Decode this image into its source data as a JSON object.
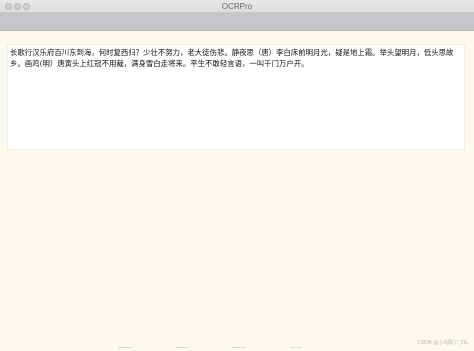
{
  "window": {
    "title": "OCRPro"
  },
  "main": {
    "ocr_text": "长歌行汉乐府百川东到海，何时复西归？少壮不努力，老大徒伤悲。静夜思（唐）李白床前明月光，疑是地上霜。举头望明月，低头思故乡。画鸡(明）唐寅头上红冠不用裁，满身雪白走将来。平生不敢轻言语，一叫千门万户开。"
  },
  "footer": {
    "watermark": "CSDN @小乌鸦丫_TIL"
  },
  "colors": {
    "background": "#fcf9ee",
    "toolbar": "#c4c6c9",
    "panel": "#ffffff",
    "text": "#111111"
  }
}
